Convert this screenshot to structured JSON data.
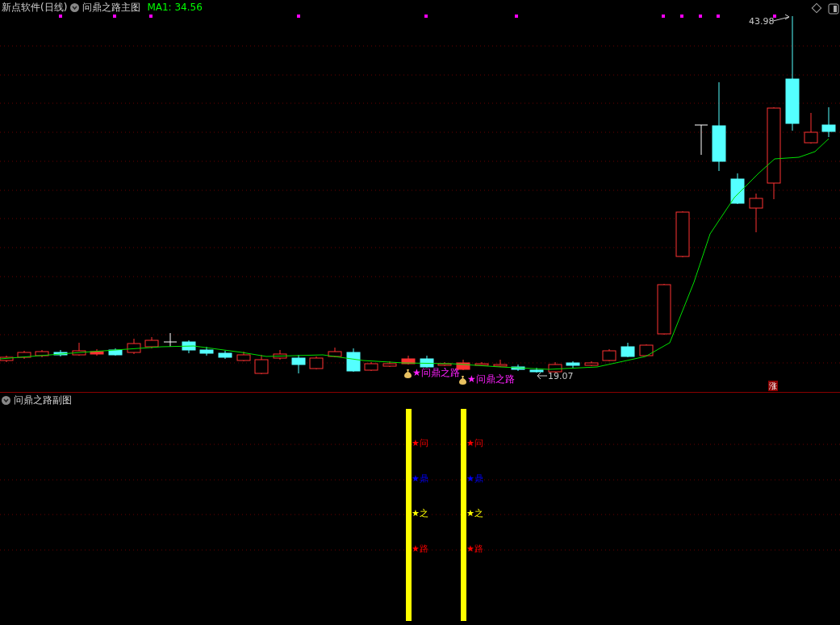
{
  "header": {
    "software": "新点软件(日线)",
    "title": "问鼎之路主图",
    "indicator": "MA1: 34.56"
  },
  "main_chart": {
    "high_label": "43.98",
    "low_label": "19.07",
    "badge": "涨",
    "signals": [
      {
        "text": "★问鼎之路"
      },
      {
        "text": "★问鼎之路"
      }
    ]
  },
  "sub_panel": {
    "title": "问鼎之路副图",
    "columns": [
      {
        "labels": [
          {
            "text": "★问",
            "color": "#ff0000"
          },
          {
            "text": "★鼎",
            "color": "#0000ff"
          },
          {
            "text": "★之",
            "color": "#ffff00"
          },
          {
            "text": "★路",
            "color": "#ff0000"
          }
        ]
      },
      {
        "labels": [
          {
            "text": "★问",
            "color": "#ff0000"
          },
          {
            "text": "★鼎",
            "color": "#0000ff"
          },
          {
            "text": "★之",
            "color": "#ffff00"
          },
          {
            "text": "★路",
            "color": "#ff0000"
          }
        ]
      }
    ]
  }
}
